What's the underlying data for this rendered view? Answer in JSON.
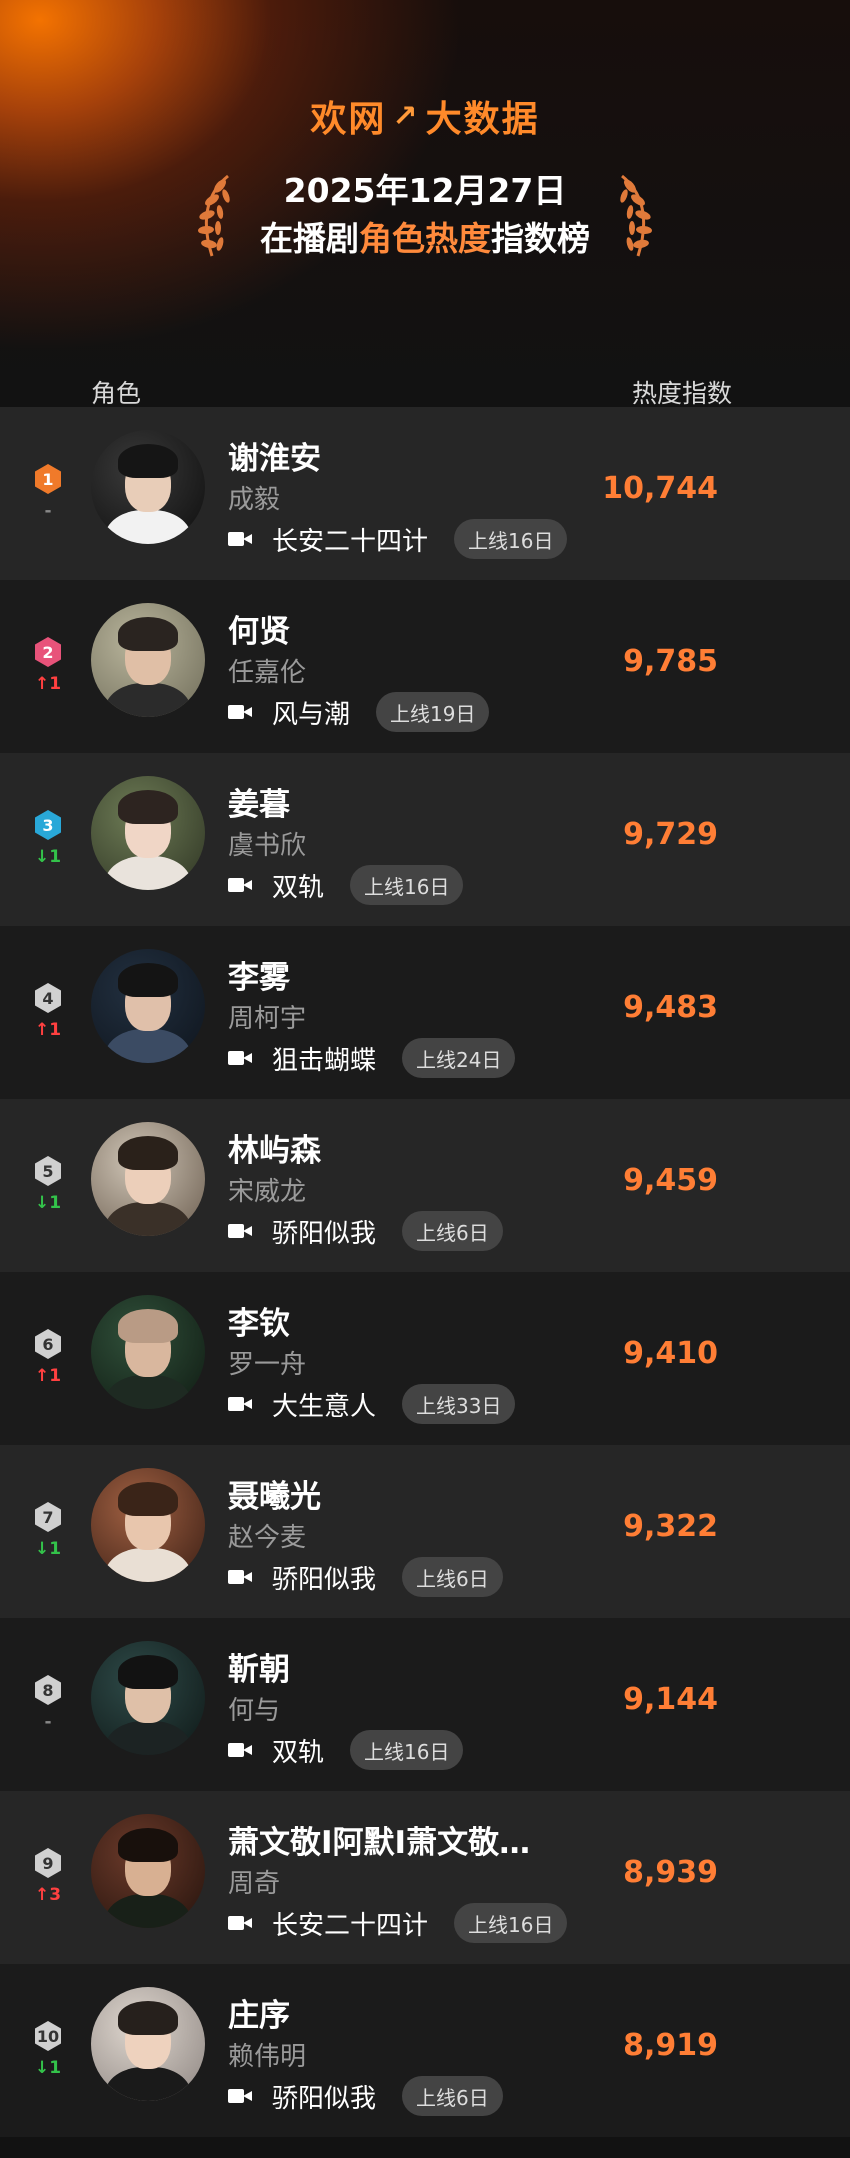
{
  "brand": {
    "text": "欢网",
    "arrow": "↗",
    "suffix": "大数据"
  },
  "title": {
    "date": "2025年12月27日",
    "prefix": "在播剧",
    "highlight": "角色热度",
    "suffix": "指数榜"
  },
  "columns": {
    "role": "角色",
    "score": "热度指数"
  },
  "colors": {
    "accent": "#ff7e35",
    "rank1": "#f07a2a",
    "rank2": "#e8537a",
    "rank3": "#29a8d8",
    "rank_other": "#d0d0d0",
    "up": "#ff4040",
    "down": "#33c24a"
  },
  "rows": [
    {
      "rank": "1",
      "change": "-",
      "name": "谢淮安",
      "actor": "成毅",
      "show": "长安二十四计",
      "days": "上线16日",
      "score": "10,744"
    },
    {
      "rank": "2",
      "change": "↑1",
      "name": "何贤",
      "actor": "任嘉伦",
      "show": "风与潮",
      "days": "上线19日",
      "score": "9,785"
    },
    {
      "rank": "3",
      "change": "↓1",
      "name": "姜暮",
      "actor": "虞书欣",
      "show": "双轨",
      "days": "上线16日",
      "score": "9,729"
    },
    {
      "rank": "4",
      "change": "↑1",
      "name": "李雾",
      "actor": "周柯宇",
      "show": "狙击蝴蝶",
      "days": "上线24日",
      "score": "9,483"
    },
    {
      "rank": "5",
      "change": "↓1",
      "name": "林屿森",
      "actor": "宋威龙",
      "show": "骄阳似我",
      "days": "上线6日",
      "score": "9,459"
    },
    {
      "rank": "6",
      "change": "↑1",
      "name": "李钦",
      "actor": "罗一舟",
      "show": "大生意人",
      "days": "上线33日",
      "score": "9,410"
    },
    {
      "rank": "7",
      "change": "↓1",
      "name": "聂曦光",
      "actor": "赵今麦",
      "show": "骄阳似我",
      "days": "上线6日",
      "score": "9,322"
    },
    {
      "rank": "8",
      "change": "-",
      "name": "靳朝",
      "actor": "何与",
      "show": "双轨",
      "days": "上线16日",
      "score": "9,144"
    },
    {
      "rank": "9",
      "change": "↑3",
      "name": "萧文敬I阿默I萧文敬…",
      "actor": "周奇",
      "show": "长安二十四计",
      "days": "上线16日",
      "score": "8,939"
    },
    {
      "rank": "10",
      "change": "↓1",
      "name": "庄序",
      "actor": "赖伟明",
      "show": "骄阳似我",
      "days": "上线6日",
      "score": "8,919"
    }
  ]
}
